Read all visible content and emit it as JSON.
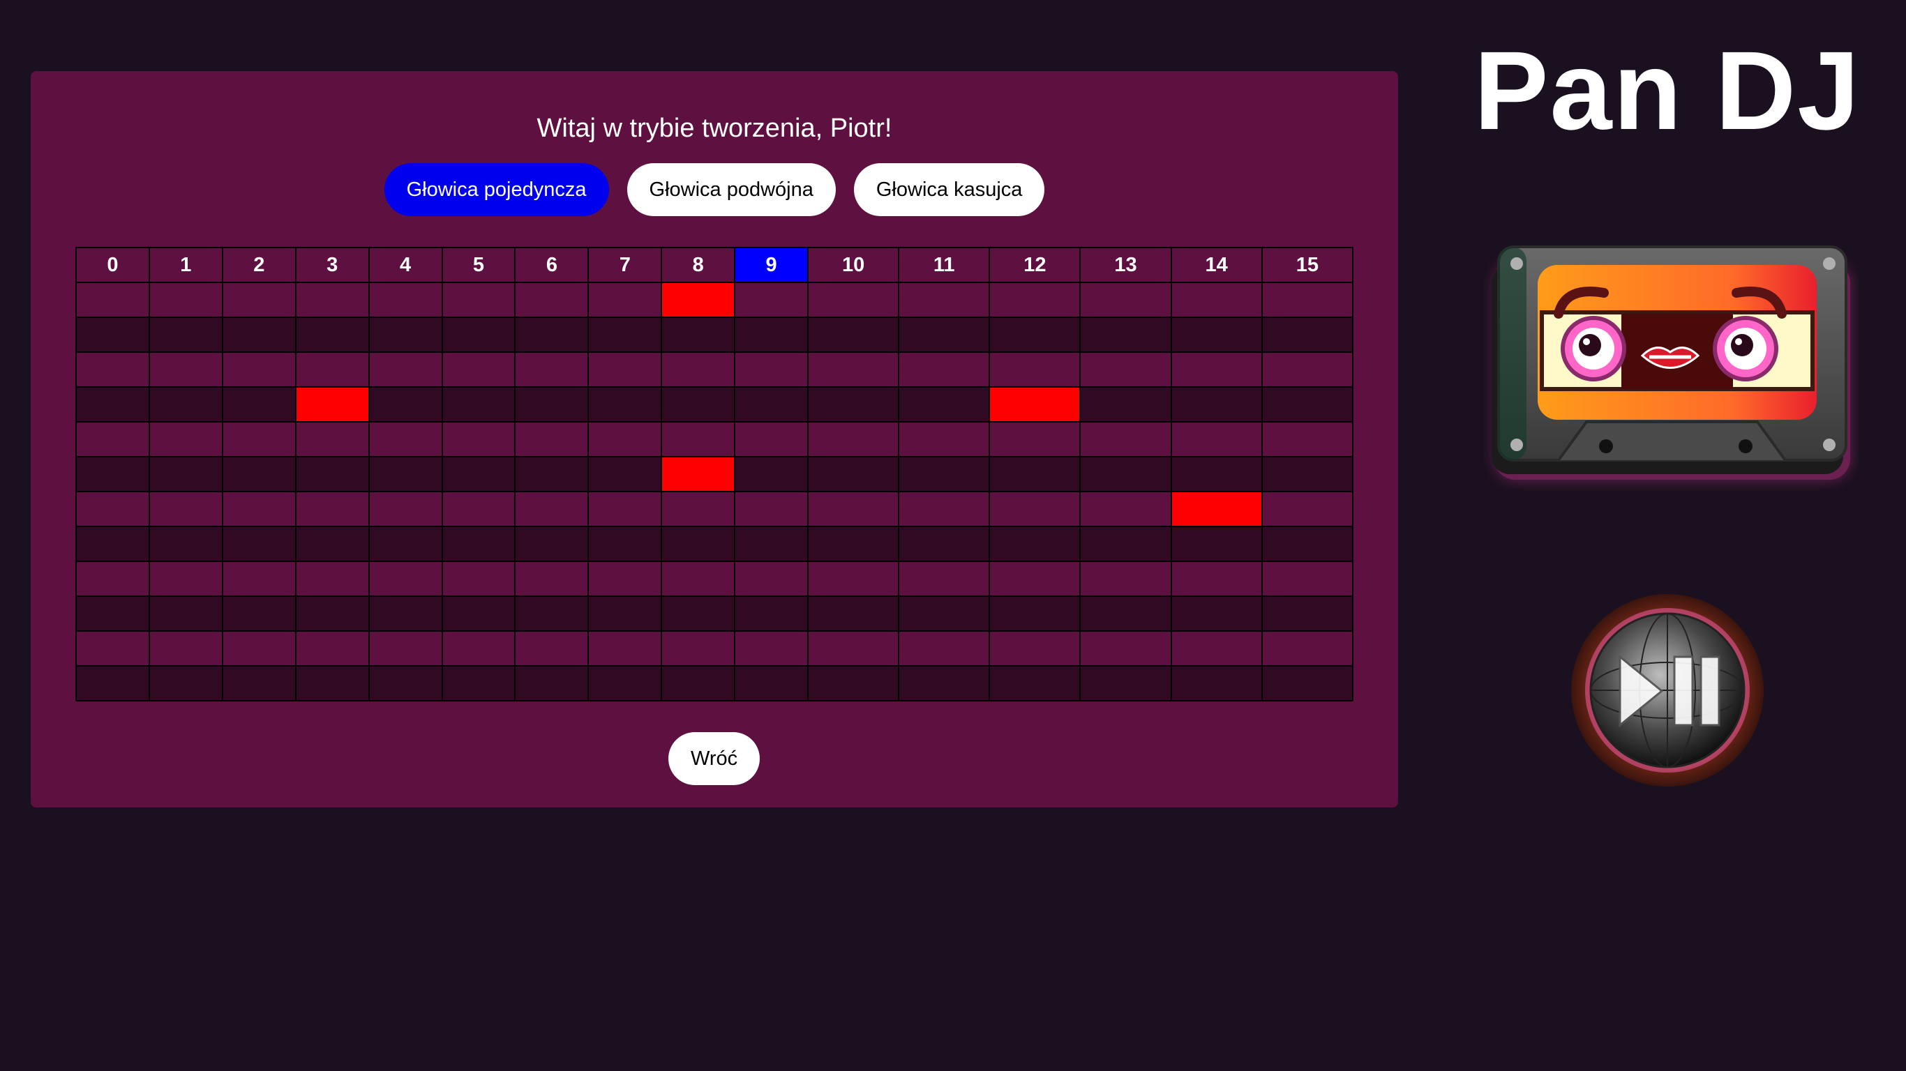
{
  "app_title": "Pan DJ",
  "welcome_text": "Witaj w trybie tworzenia, Piotr!",
  "mode_buttons": [
    {
      "label": "Głowica pojedyncza",
      "active": true
    },
    {
      "label": "Głowica podwójna",
      "active": false
    },
    {
      "label": "Głowica kasujca",
      "active": false
    }
  ],
  "sequencer": {
    "columns": [
      "0",
      "1",
      "2",
      "3",
      "4",
      "5",
      "6",
      "7",
      "8",
      "9",
      "10",
      "11",
      "12",
      "13",
      "14",
      "15"
    ],
    "playhead_column": 9,
    "row_count": 12,
    "active_cells": [
      {
        "row": 0,
        "col": 8
      },
      {
        "row": 3,
        "col": 3
      },
      {
        "row": 3,
        "col": 12
      },
      {
        "row": 5,
        "col": 8
      },
      {
        "row": 6,
        "col": 14
      }
    ]
  },
  "back_button_label": "Wróć",
  "colors": {
    "background": "#1a101f",
    "panel": "#5e1140",
    "row_dark": "#2f0a22",
    "active_cell": "#ff0000",
    "playhead": "#0000ff",
    "active_button": "#0000ee"
  },
  "icons": {
    "cassette": "cassette-mascot-icon",
    "play_pause": "play-pause-icon"
  }
}
